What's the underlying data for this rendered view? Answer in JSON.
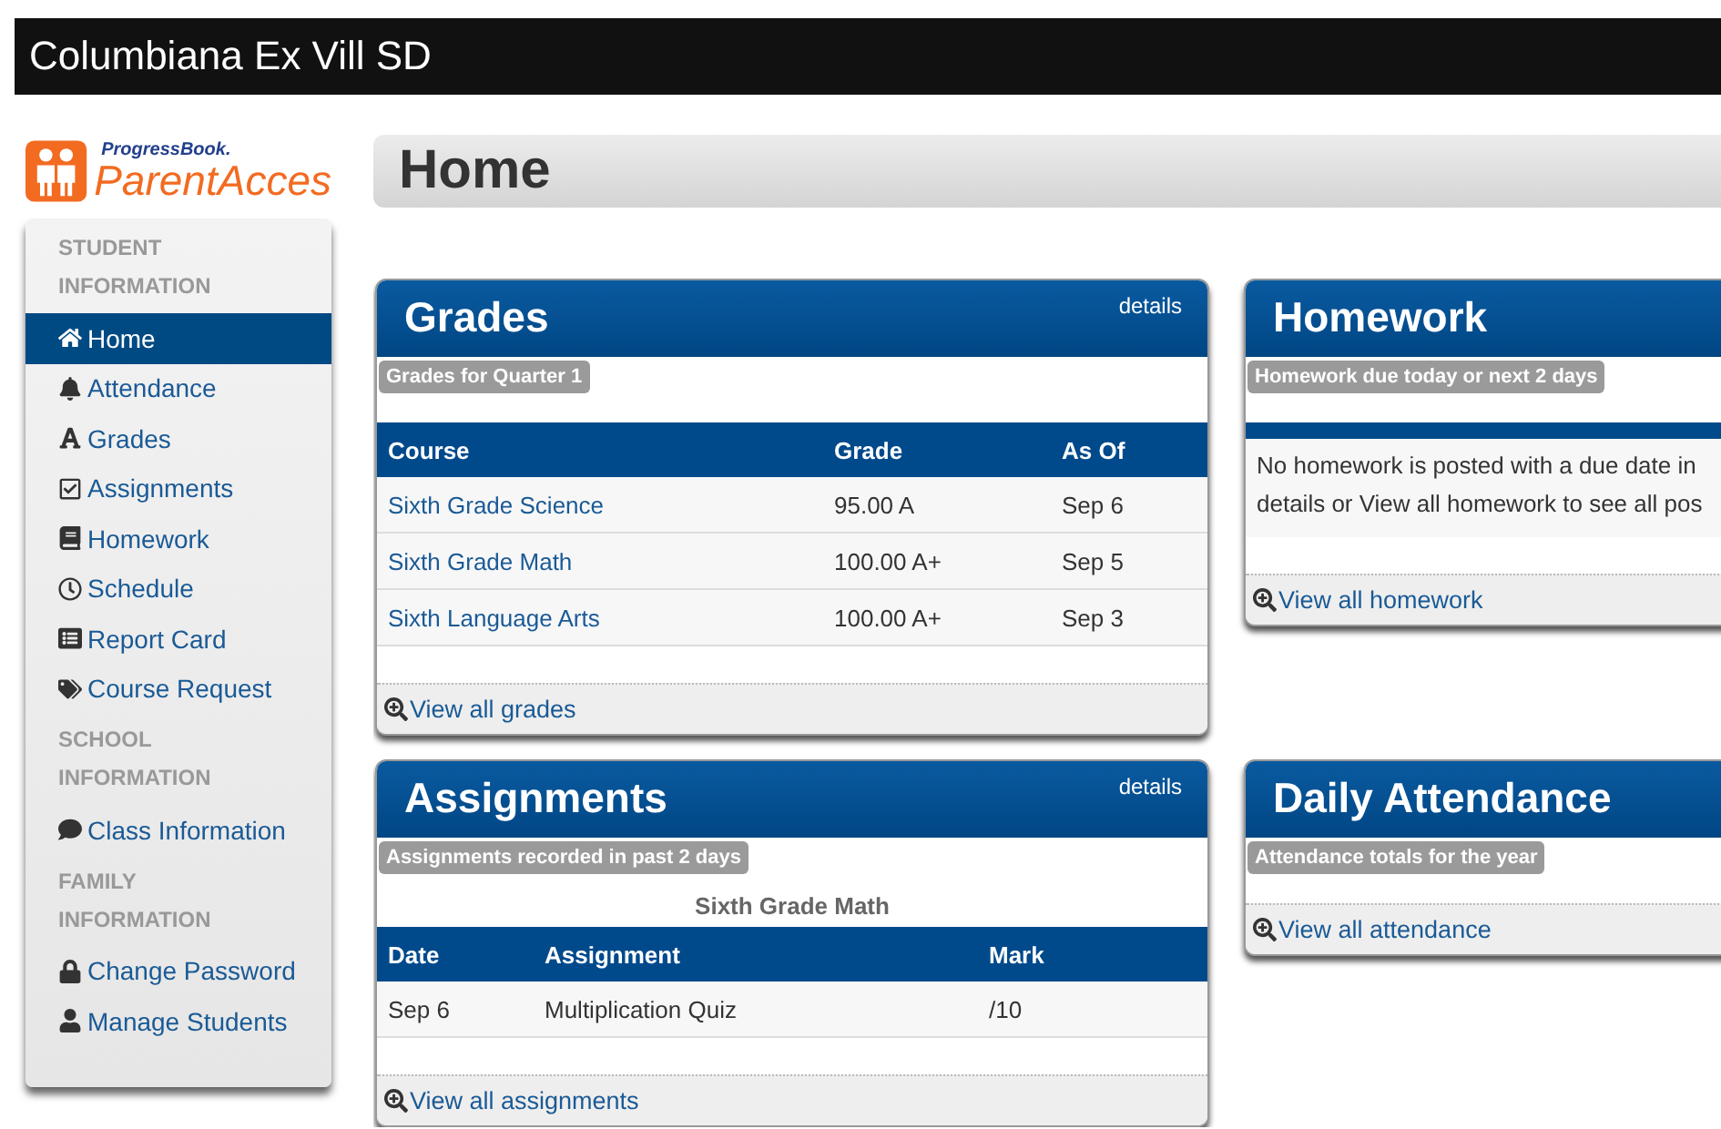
{
  "header": {
    "title": "Columbiana Ex Vill SD"
  },
  "logo": {
    "brand": "ProgressBook.",
    "product": "ParentAcces"
  },
  "sidebar": {
    "sections": [
      {
        "heading": "STUDENT INFORMATION",
        "items": [
          {
            "label": "Home",
            "kind": "home",
            "selected": true
          },
          {
            "label": "Attendance",
            "kind": "bell",
            "selected": false
          },
          {
            "label": "Grades",
            "kind": "letter",
            "selected": false
          },
          {
            "label": "Assignments",
            "kind": "check",
            "selected": false
          },
          {
            "label": "Homework",
            "kind": "book",
            "selected": false
          },
          {
            "label": "Schedule",
            "kind": "clock",
            "selected": false
          },
          {
            "label": "Report Card",
            "kind": "list",
            "selected": false
          },
          {
            "label": "Course Request",
            "kind": "tags",
            "selected": false
          }
        ]
      },
      {
        "heading": "SCHOOL INFORMATION",
        "items": [
          {
            "label": "Class Information",
            "kind": "comment",
            "selected": false
          }
        ]
      },
      {
        "heading": "FAMILY INFORMATION",
        "items": [
          {
            "label": "Change Password",
            "kind": "lock",
            "selected": false
          },
          {
            "label": "Manage Students",
            "kind": "user",
            "selected": false
          }
        ]
      }
    ]
  },
  "page_title": "Home",
  "cards": [
    {
      "kind": "grades",
      "title": "Grades",
      "details": "details",
      "badge": "Grades for Quarter 1",
      "table": {
        "columns": [
          {
            "label": "Course",
            "link": true
          },
          {
            "label": "Grade",
            "link": false
          },
          {
            "label": "As Of",
            "link": false
          }
        ],
        "rows": [
          [
            "Sixth Grade Science",
            "95.00 A",
            "Sep 6"
          ],
          [
            "Sixth Grade Math",
            "100.00 A+",
            "Sep 5"
          ],
          [
            "Sixth Language Arts",
            "100.00 A+",
            "Sep 3"
          ]
        ]
      },
      "footer_link": "View all grades"
    },
    {
      "kind": "message",
      "title": "Homework",
      "badge": "Homework due today or next 2 days",
      "message_lines": [
        "No homework is posted with a due date in",
        "details or View all homework to see all pos"
      ],
      "footer_link": "View all homework"
    },
    {
      "kind": "assignments",
      "title": "Assignments",
      "details": "details",
      "badge": "Assignments recorded in past 2 days",
      "caption": "Sixth Grade Math",
      "table": {
        "columns": [
          {
            "label": "Date",
            "link": false
          },
          {
            "label": "Assignment",
            "link": false
          },
          {
            "label": "Mark",
            "link": false
          }
        ],
        "rows": [
          [
            "Sep 6",
            "Multiplication Quiz",
            "/10"
          ]
        ]
      },
      "footer_link": "View all assignments"
    },
    {
      "kind": "plain",
      "title": "Daily Attendance",
      "badge": "Attendance totals for the year",
      "footer_link": "View all attendance"
    }
  ]
}
